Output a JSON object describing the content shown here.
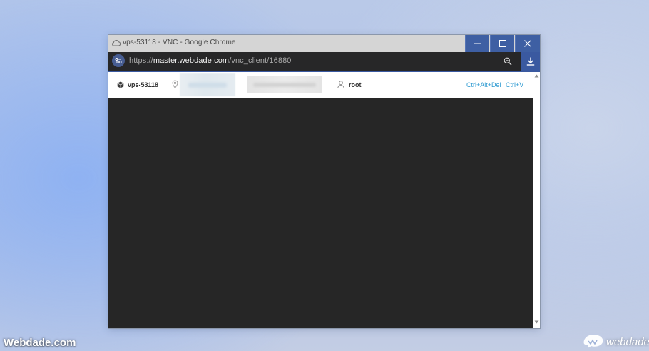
{
  "colors": {
    "titlebar": "#d5d5d5",
    "window_buttons": "#3e5fa3",
    "address_bar": "#272728",
    "link": "#2f9bd2",
    "vnc_canvas": "#262626"
  },
  "window": {
    "title": "vps-53118 - VNC - Google Chrome",
    "title_icon": "cloud-icon",
    "buttons": [
      "minimize-icon",
      "maximize-icon",
      "close-icon"
    ]
  },
  "address_bar": {
    "url_scheme": "https://",
    "url_host": "master.webdade.com",
    "url_path": "/vnc_client/16880",
    "left_icon": "site-settings-icon",
    "zoom_icon": "zoom-out-icon",
    "download_icon": "download-icon"
  },
  "info_bar": {
    "server_name": "vps-53118",
    "server_icon": "cube-icon",
    "ip_icon": "location-pin-icon",
    "user_icon": "user-icon",
    "username": "root",
    "ctrl_alt_del": "Ctrl+Alt+Del",
    "ctrl_v": "Ctrl+V"
  },
  "watermark": {
    "left_text": "Webdade.com",
    "right_text": "webdade"
  }
}
